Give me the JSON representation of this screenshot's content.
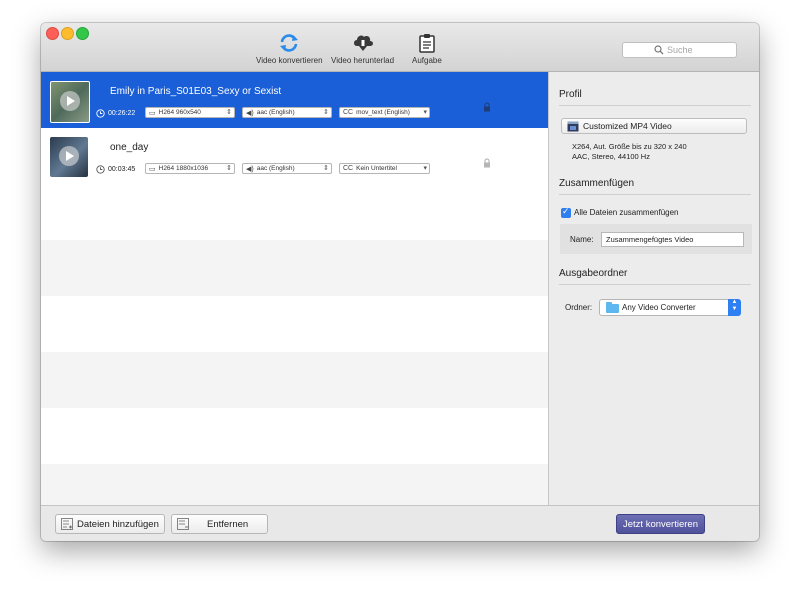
{
  "window": {
    "controls": [
      "close",
      "minimize",
      "zoom"
    ]
  },
  "toolbar": {
    "items": [
      {
        "label": "Video konvertieren",
        "icon": "refresh-icon"
      },
      {
        "label": "Video herunterlad",
        "icon": "cloud-download-icon"
      },
      {
        "label": "Aufgabe",
        "icon": "clipboard-icon"
      }
    ],
    "search": {
      "placeholder": "Suche"
    }
  },
  "files": [
    {
      "title": "Emily in Paris_S01E03_Sexy or Sexist",
      "duration": "00:26:22",
      "video": "H264 960x540",
      "audio": "aac (English)",
      "subtitle": "mov_text (English)",
      "selected": true
    },
    {
      "title": "one_day",
      "duration": "00:03:45",
      "video": "H264 1880x1036",
      "audio": "aac (English)",
      "subtitle": "Kein Untertitel",
      "selected": false
    }
  ],
  "profile": {
    "heading": "Profil",
    "name": "Customized MP4 Video",
    "desc_line1": "X264, Aut. Größe bis zu 320 x 240",
    "desc_line2": "AAC, Stereo, 44100 Hz"
  },
  "merge": {
    "heading": "Zusammenfügen",
    "checkbox_label": "Alle Dateien zusammenfügen",
    "checked": true,
    "name_label": "Name:",
    "name_value": "Zusammengefügtes Video"
  },
  "output": {
    "heading": "Ausgabeordner",
    "folder_label": "Ordner:",
    "folder_value": "Any Video Converter"
  },
  "bottom": {
    "add_label": "Dateien hinzufügen",
    "remove_label": "Entfernen",
    "convert_label": "Jetzt konvertieren"
  },
  "colors": {
    "selection": "#1a5fd8",
    "accent": "#2e7ff2",
    "convert": "#5a5ca4"
  }
}
